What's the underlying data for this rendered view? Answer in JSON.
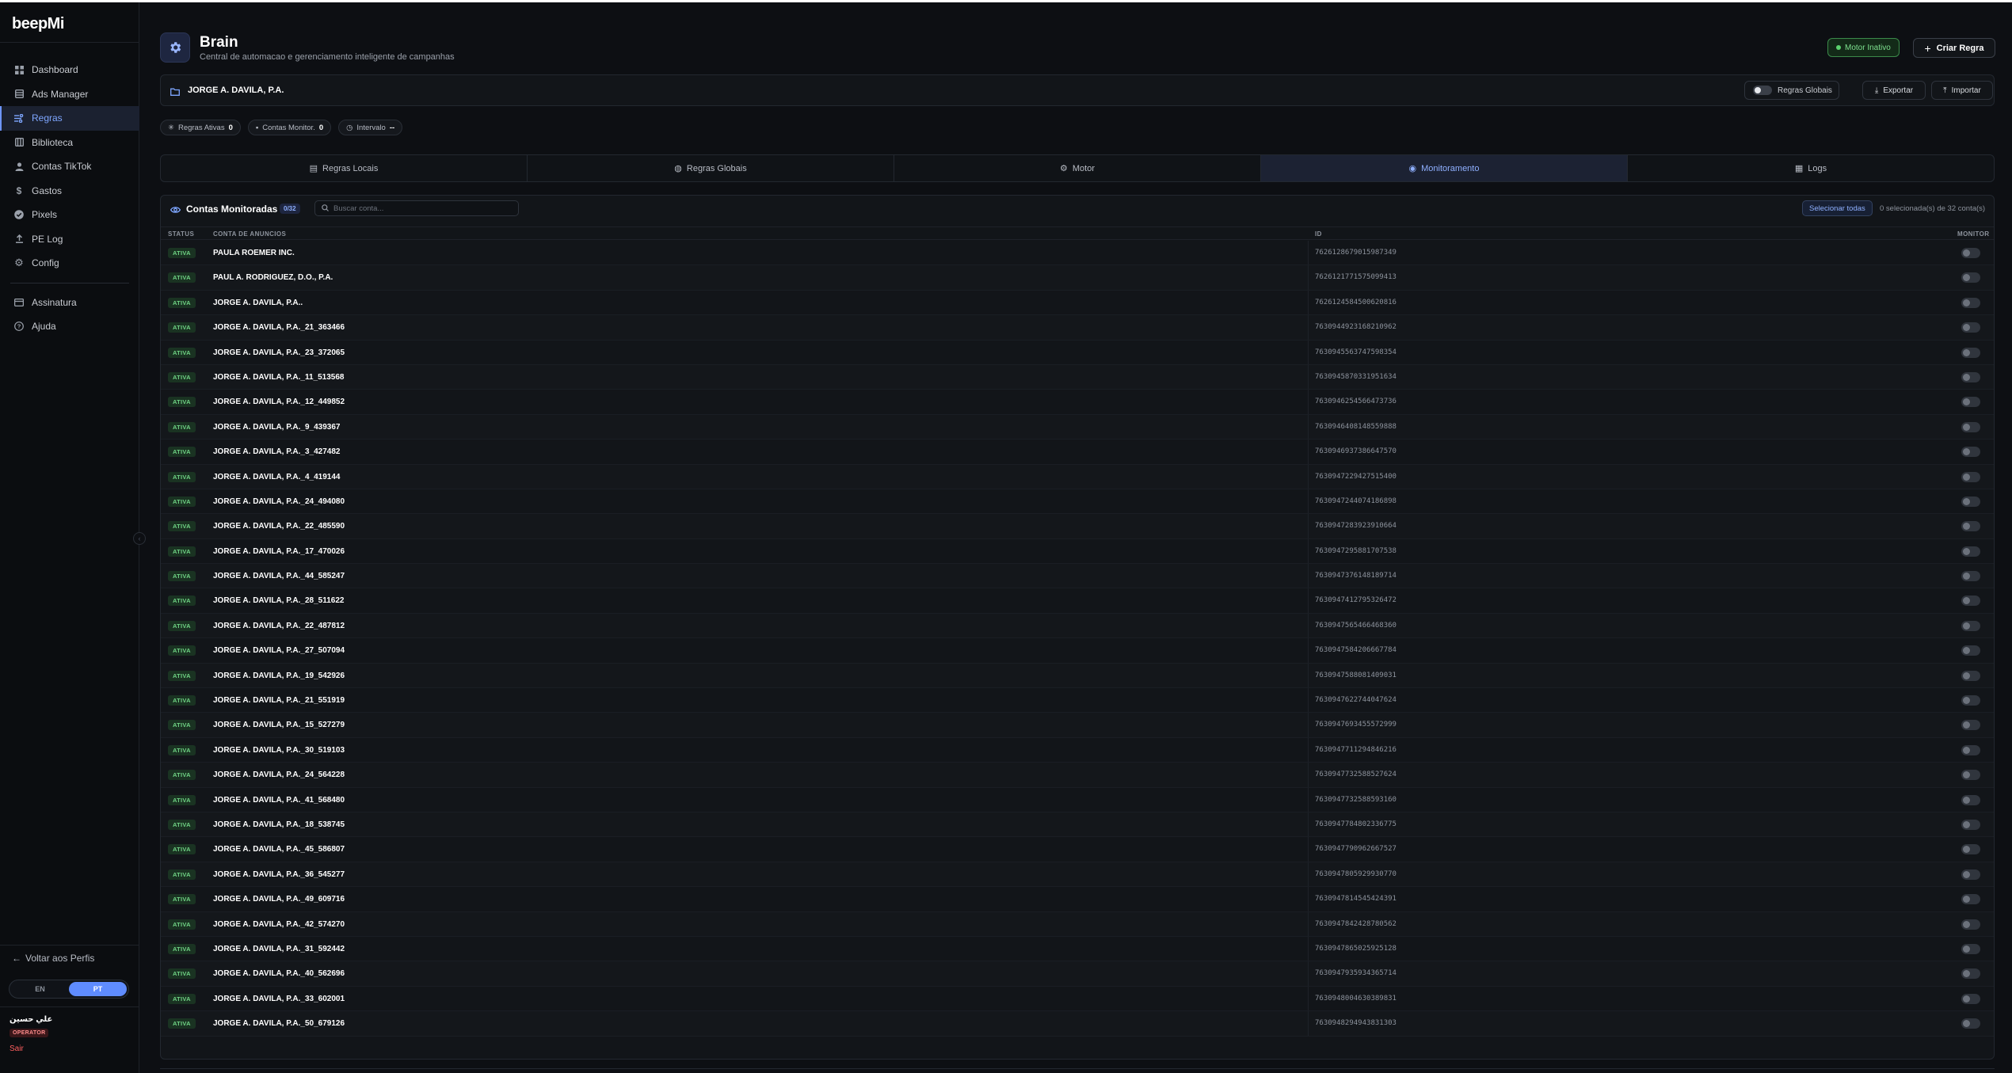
{
  "brand": "beepMi",
  "sidebar": {
    "items": [
      {
        "label": "Dashboard",
        "icon": "grid-icon"
      },
      {
        "label": "Ads Manager",
        "icon": "table-icon"
      },
      {
        "label": "Regras",
        "icon": "rules-icon",
        "active": true
      },
      {
        "label": "Biblioteca",
        "icon": "library-icon"
      },
      {
        "label": "Contas TikTok",
        "icon": "user-icon"
      },
      {
        "label": "Gastos",
        "icon": "dollar-icon"
      },
      {
        "label": "Pixels",
        "icon": "check-circle-icon"
      },
      {
        "label": "PE Log",
        "icon": "upload-icon"
      },
      {
        "label": "Config",
        "icon": "gear-icon"
      }
    ],
    "items2": [
      {
        "label": "Assinatura",
        "icon": "card-icon"
      },
      {
        "label": "Ajuda",
        "icon": "help-icon"
      }
    ],
    "back_label": "Voltar aos Perfis",
    "lang": {
      "en": "EN",
      "pt": "PT",
      "selected": "PT"
    },
    "user": {
      "name": "علي حسين",
      "role": "OPERATOR",
      "exit": "Sair"
    }
  },
  "header": {
    "title": "Brain",
    "subtitle": "Central de automacao e gerenciamento inteligente de campanhas",
    "motor_status": "Motor Inativo",
    "create_label": "Criar Regra"
  },
  "account_bar": {
    "name": "JORGE A. DAVILA, P.A.",
    "global_label": "Regras Globais",
    "export_label": "Exportar",
    "import_label": "Importar"
  },
  "chips": {
    "active_label": "Regras Ativas",
    "active_value": "0",
    "monitor_label": "Contas Monitor.",
    "monitor_value": "0",
    "interval_label": "Intervalo",
    "interval_value": "--"
  },
  "tabs": [
    {
      "label": "Regras Locais",
      "icon": "list-icon"
    },
    {
      "label": "Regras Globais",
      "icon": "globe-icon"
    },
    {
      "label": "Motor",
      "icon": "gear-icon"
    },
    {
      "label": "Monitoramento",
      "icon": "eye-icon",
      "active": true
    },
    {
      "label": "Logs",
      "icon": "log-icon"
    }
  ],
  "panel": {
    "title": "Contas Monitoradas",
    "count": "0/32",
    "search_placeholder": "Buscar conta...",
    "select_all": "Selecionar todas",
    "selection_info": "0 selecionada(s) de 32 conta(s)",
    "columns": {
      "status": "STATUS",
      "account": "CONTA DE ANUNCIOS",
      "id": "ID",
      "monitor": "MONITOR"
    }
  },
  "rows": [
    {
      "status": "ATIVA",
      "name": "PAULA ROEMER INC.",
      "id": "7626128679015987349"
    },
    {
      "status": "ATIVA",
      "name": "PAUL A. RODRIGUEZ, D.O., P.A.",
      "id": "7626121771575099413"
    },
    {
      "status": "ATIVA",
      "name": "JORGE A. DAVILA, P.A..",
      "id": "7626124584500620816"
    },
    {
      "status": "ATIVA",
      "name": "JORGE A. DAVILA, P.A._21_363466",
      "id": "7630944923168210962"
    },
    {
      "status": "ATIVA",
      "name": "JORGE A. DAVILA, P.A._23_372065",
      "id": "7630945563747598354"
    },
    {
      "status": "ATIVA",
      "name": "JORGE A. DAVILA, P.A._11_513568",
      "id": "7630945870331951634"
    },
    {
      "status": "ATIVA",
      "name": "JORGE A. DAVILA, P.A._12_449852",
      "id": "7630946254566473736"
    },
    {
      "status": "ATIVA",
      "name": "JORGE A. DAVILA, P.A._9_439367",
      "id": "7630946408148559888"
    },
    {
      "status": "ATIVA",
      "name": "JORGE A. DAVILA, P.A._3_427482",
      "id": "7630946937386647570"
    },
    {
      "status": "ATIVA",
      "name": "JORGE A. DAVILA, P.A._4_419144",
      "id": "7630947229427515400"
    },
    {
      "status": "ATIVA",
      "name": "JORGE A. DAVILA, P.A._24_494080",
      "id": "7630947244074186898"
    },
    {
      "status": "ATIVA",
      "name": "JORGE A. DAVILA, P.A._22_485590",
      "id": "7630947283923910664"
    },
    {
      "status": "ATIVA",
      "name": "JORGE A. DAVILA, P.A._17_470026",
      "id": "7630947295881707538"
    },
    {
      "status": "ATIVA",
      "name": "JORGE A. DAVILA, P.A._44_585247",
      "id": "7630947376148189714"
    },
    {
      "status": "ATIVA",
      "name": "JORGE A. DAVILA, P.A._28_511622",
      "id": "7630947412795326472"
    },
    {
      "status": "ATIVA",
      "name": "JORGE A. DAVILA, P.A._22_487812",
      "id": "7630947565466468360"
    },
    {
      "status": "ATIVA",
      "name": "JORGE A. DAVILA, P.A._27_507094",
      "id": "7630947584206667784"
    },
    {
      "status": "ATIVA",
      "name": "JORGE A. DAVILA, P.A._19_542926",
      "id": "7630947588081409031"
    },
    {
      "status": "ATIVA",
      "name": "JORGE A. DAVILA, P.A._21_551919",
      "id": "7630947622744047624"
    },
    {
      "status": "ATIVA",
      "name": "JORGE A. DAVILA, P.A._15_527279",
      "id": "7630947693455572999"
    },
    {
      "status": "ATIVA",
      "name": "JORGE A. DAVILA, P.A._30_519103",
      "id": "7630947711294846216"
    },
    {
      "status": "ATIVA",
      "name": "JORGE A. DAVILA, P.A._24_564228",
      "id": "7630947732588527624"
    },
    {
      "status": "ATIVA",
      "name": "JORGE A. DAVILA, P.A._41_568480",
      "id": "7630947732588593160"
    },
    {
      "status": "ATIVA",
      "name": "JORGE A. DAVILA, P.A._18_538745",
      "id": "7630947784802336775"
    },
    {
      "status": "ATIVA",
      "name": "JORGE A. DAVILA, P.A._45_586807",
      "id": "7630947790962667527"
    },
    {
      "status": "ATIVA",
      "name": "JORGE A. DAVILA, P.A._36_545277",
      "id": "7630947805929930770"
    },
    {
      "status": "ATIVA",
      "name": "JORGE A. DAVILA, P.A._49_609716",
      "id": "7630947814545424391"
    },
    {
      "status": "ATIVA",
      "name": "JORGE A. DAVILA, P.A._42_574270",
      "id": "7630947842428780562"
    },
    {
      "status": "ATIVA",
      "name": "JORGE A. DAVILA, P.A._31_592442",
      "id": "7630947865025925128"
    },
    {
      "status": "ATIVA",
      "name": "JORGE A. DAVILA, P.A._40_562696",
      "id": "7630947935934365714"
    },
    {
      "status": "ATIVA",
      "name": "JORGE A. DAVILA, P.A._33_602001",
      "id": "7630948004630389831"
    },
    {
      "status": "ATIVA",
      "name": "JORGE A. DAVILA, P.A._50_679126",
      "id": "7630948294943831303"
    }
  ],
  "colors": {
    "accent": "#6e95ff",
    "active_green": "#6fd384",
    "bg": "#0d0f13"
  }
}
